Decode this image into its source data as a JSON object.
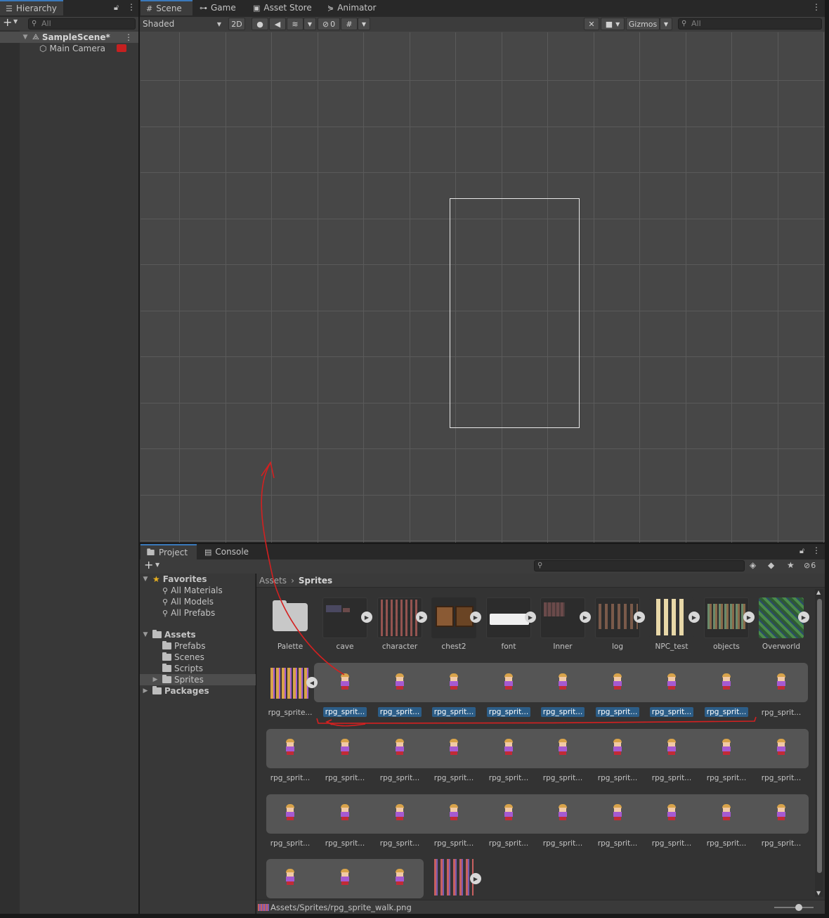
{
  "hierarchy": {
    "tab_label": "Hierarchy",
    "search_placeholder": "All",
    "scene_name": "SampleScene*",
    "items": [
      "Main Camera"
    ]
  },
  "scene_view": {
    "tabs": [
      "Scene",
      "Game",
      "Asset Store",
      "Animator"
    ],
    "shading_mode": "Shaded",
    "mode_2d": "2D",
    "hidden_count": "0",
    "gizmos_label": "Gizmos",
    "search_placeholder": "All"
  },
  "project_panel": {
    "tabs": [
      "Project",
      "Console"
    ],
    "hidden_count": "6",
    "favorites_label": "Favorites",
    "favorites": [
      "All Materials",
      "All Models",
      "All Prefabs"
    ],
    "assets_label": "Assets",
    "asset_folders": [
      "Prefabs",
      "Scenes",
      "Scripts",
      "Sprites"
    ],
    "packages_label": "Packages",
    "breadcrumb": [
      "Assets",
      "Sprites"
    ],
    "row1": [
      "Palette",
      "cave",
      "character",
      "chest2",
      "font",
      "Inner",
      "log",
      "NPC_test",
      "objects",
      "Overworld"
    ],
    "row2_parent_label": "rpg_sprite...",
    "row2_sub_labels": [
      "rpg_sprit...",
      "rpg_sprit...",
      "rpg_sprit...",
      "rpg_sprit...",
      "rpg_sprit...",
      "rpg_sprit...",
      "rpg_sprit...",
      "rpg_sprit...",
      "rpg_sprit..."
    ],
    "row3_labels": [
      "rpg_sprit...",
      "rpg_sprit...",
      "rpg_sprit...",
      "rpg_sprit...",
      "rpg_sprit...",
      "rpg_sprit...",
      "rpg_sprit...",
      "rpg_sprit...",
      "rpg_sprit...",
      "rpg_sprit..."
    ],
    "row4_labels": [
      "rpg_sprit...",
      "rpg_sprit...",
      "rpg_sprit...",
      "rpg_sprit...",
      "rpg_sprit...",
      "rpg_sprit...",
      "rpg_sprit...",
      "rpg_sprit...",
      "rpg_sprit...",
      "rpg_sprit..."
    ],
    "status_path": "Assets/Sprites/rpg_sprite_walk.png"
  },
  "colors": {
    "accent": "#3a79bb",
    "selection": "#2c5d87",
    "annotation": "#d42020",
    "scene_bg": "#474747"
  }
}
